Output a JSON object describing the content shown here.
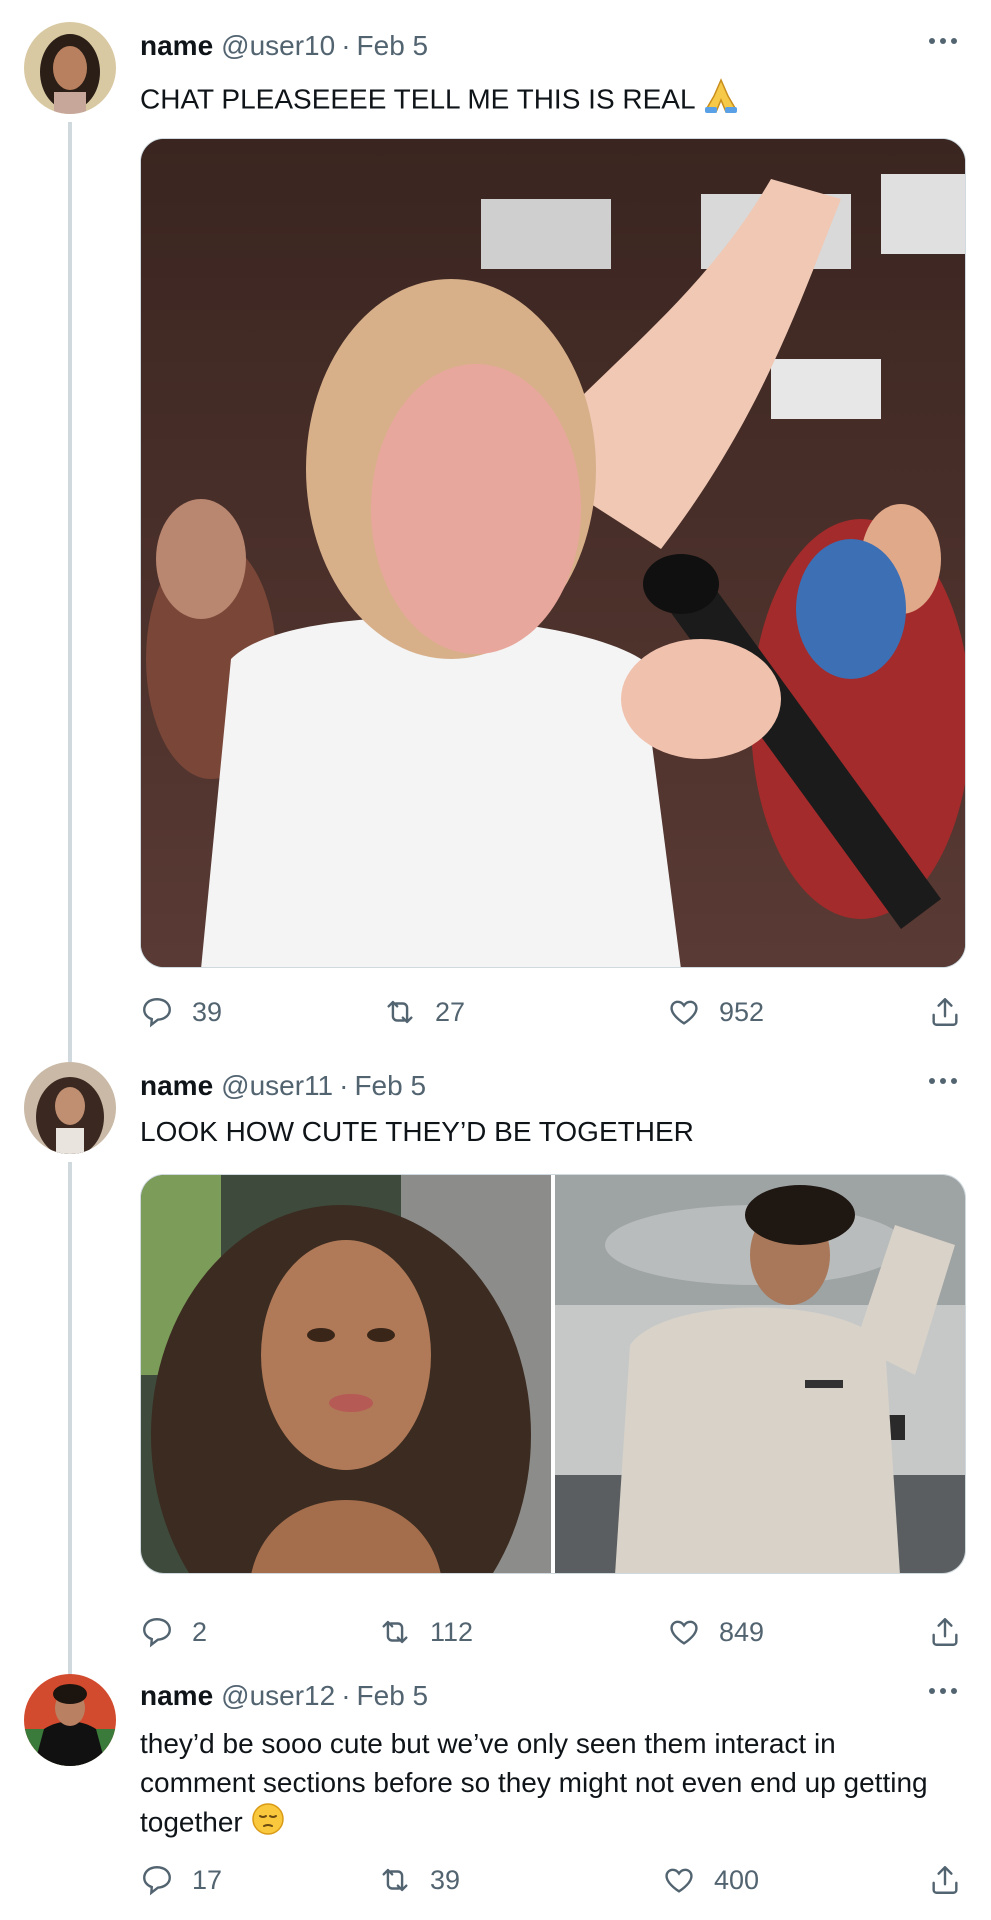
{
  "tweets": [
    {
      "name": "name",
      "handle": "@user10",
      "separator": "·",
      "date": "Feb 5",
      "text": "CHAT PLEASEEEE TELL ME THIS IS REAL",
      "emoji": "folded-hands",
      "media": "photo-crying-girl-microphone",
      "replies": "39",
      "retweets": "27",
      "likes": "952"
    },
    {
      "name": "name",
      "handle": "@user11",
      "separator": "·",
      "date": "Feb 5",
      "text": "LOOK HOW CUTE THEY’D BE TOGETHER",
      "media": [
        "photo-curly-hair-selfie",
        "photo-man-hoodie"
      ],
      "replies": "2",
      "retweets": "112",
      "likes": "849"
    },
    {
      "name": "name",
      "handle": "@user12",
      "separator": "·",
      "date": "Feb 5",
      "text_lines": [
        "they’d be sooo cute but we’ve only seen them interact in",
        "comment sections before so they might not even end up getting",
        "together"
      ],
      "emoji": "pensive-face",
      "replies": "17",
      "retweets": "39",
      "likes": "400"
    }
  ],
  "colors": {
    "text": "#0f1419",
    "secondary": "#536471",
    "thread_line": "#cfd9de"
  }
}
